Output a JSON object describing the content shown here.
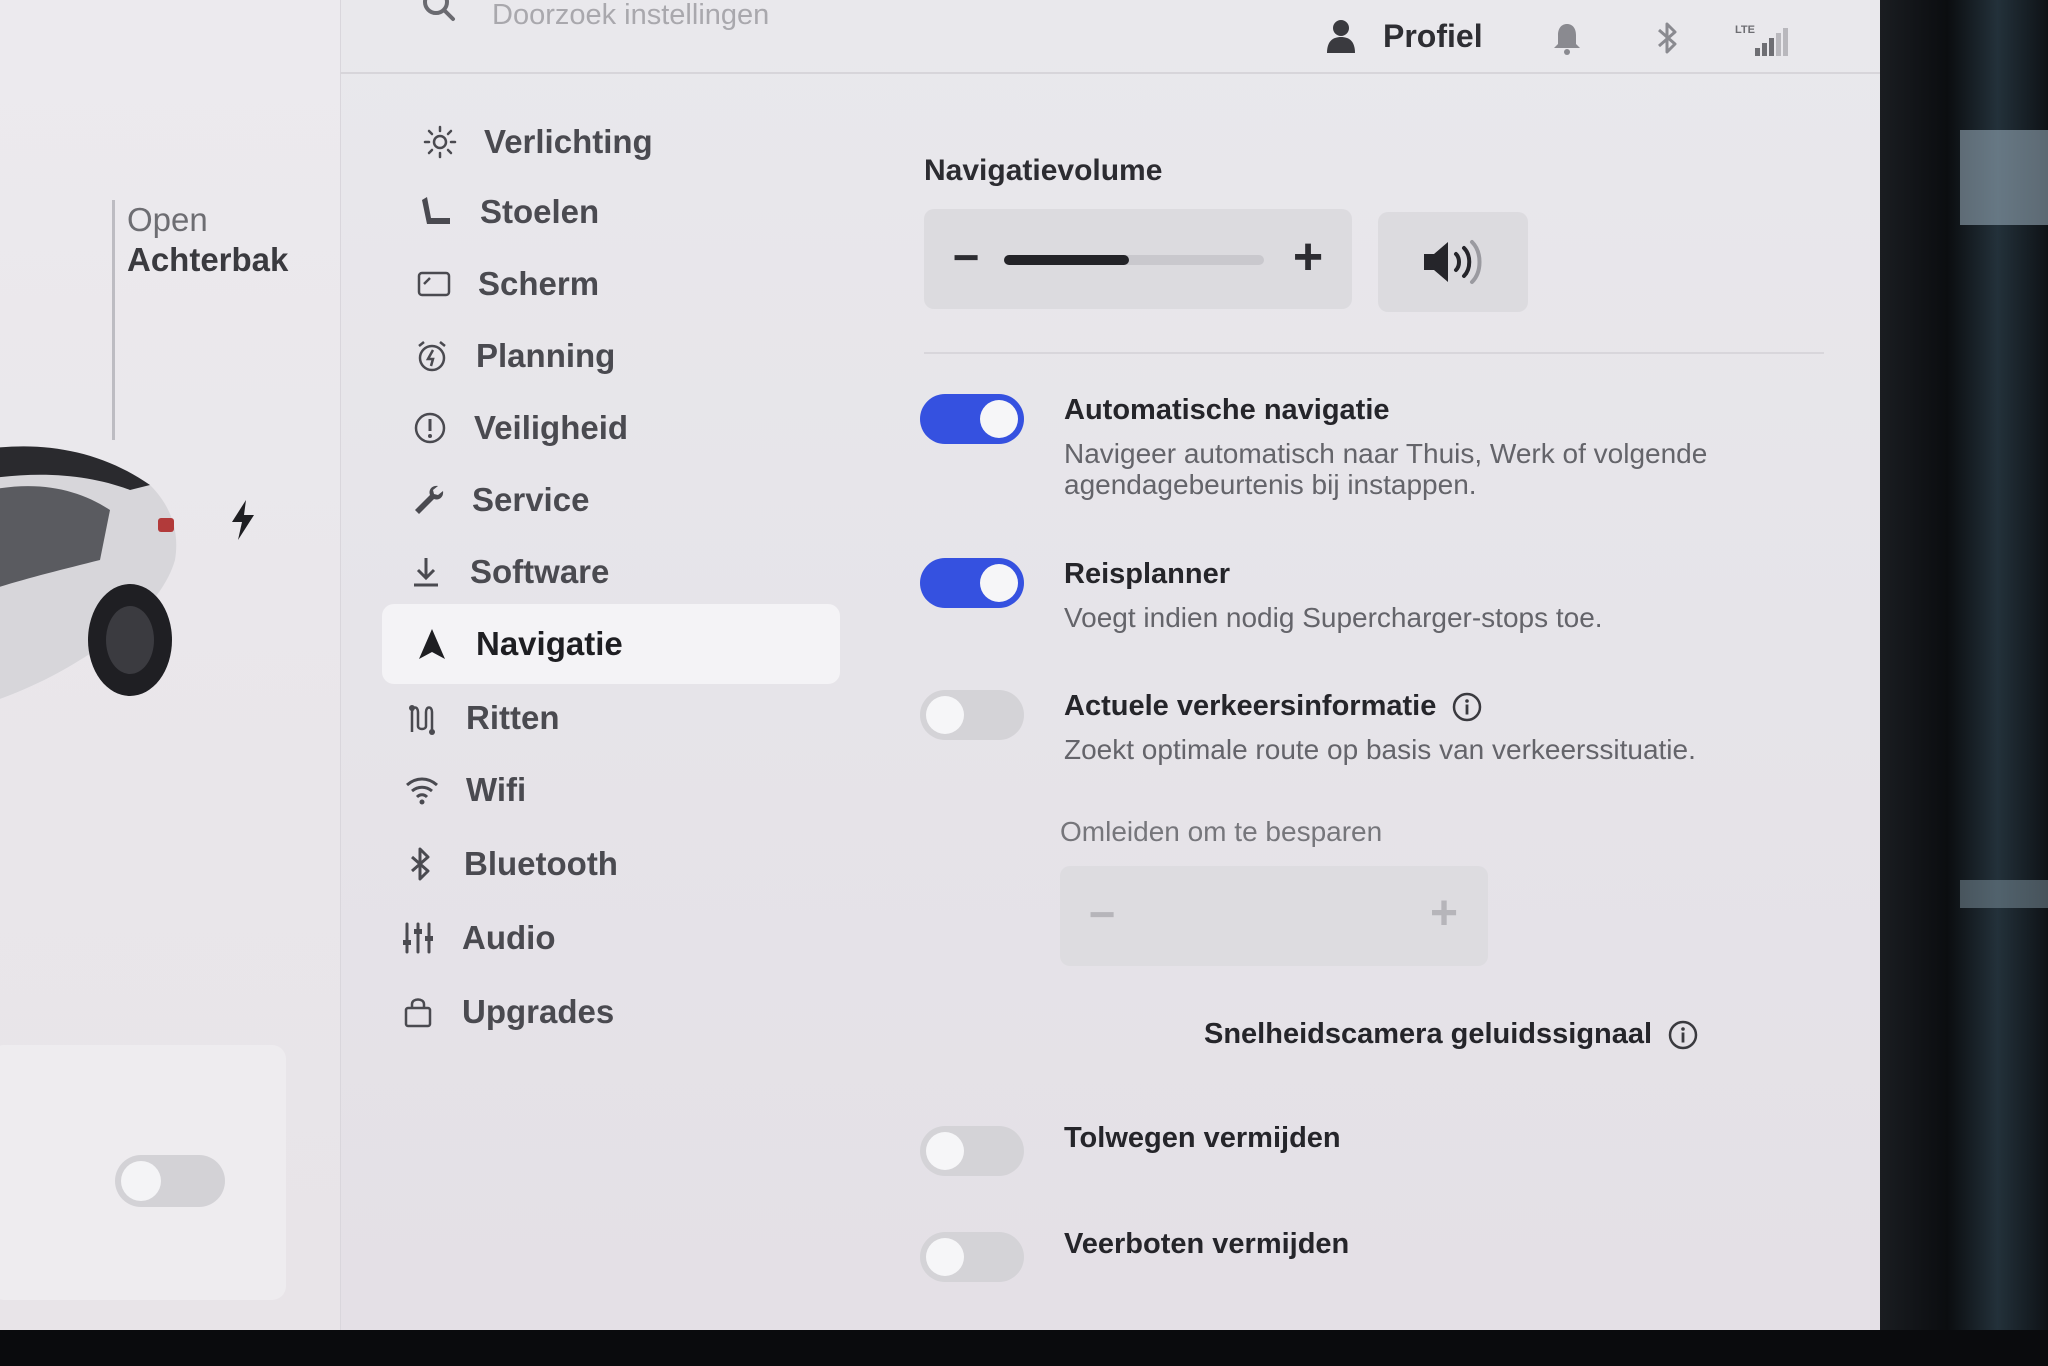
{
  "topbar": {
    "search_placeholder": "Doorzoek instellingen",
    "profile_label": "Profiel",
    "signal_label": "LTE"
  },
  "car_panel": {
    "trunk_line1": "Open",
    "trunk_line2": "Achterbak"
  },
  "nav": {
    "items": [
      {
        "label": "Verlichting",
        "icon": "sun-icon"
      },
      {
        "label": "Stoelen",
        "icon": "seat-icon"
      },
      {
        "label": "Scherm",
        "icon": "display-icon"
      },
      {
        "label": "Planning",
        "icon": "alarm-clock-icon"
      },
      {
        "label": "Veiligheid",
        "icon": "alert-circle-icon"
      },
      {
        "label": "Service",
        "icon": "wrench-icon"
      },
      {
        "label": "Software",
        "icon": "download-icon"
      },
      {
        "label": "Navigatie",
        "icon": "navigation-arrow-icon",
        "active": true
      },
      {
        "label": "Ritten",
        "icon": "trips-icon"
      },
      {
        "label": "Wifi",
        "icon": "wifi-icon"
      },
      {
        "label": "Bluetooth",
        "icon": "bluetooth-icon"
      },
      {
        "label": "Audio",
        "icon": "equalizer-icon"
      },
      {
        "label": "Upgrades",
        "icon": "shopping-bag-icon"
      }
    ]
  },
  "navigation": {
    "volume_title": "Navigatievolume",
    "volume_level": 0.48,
    "options": [
      {
        "title": "Automatische navigatie",
        "desc": "Navigeer automatisch naar Thuis, Werk of volgende agendagebeurtenis bij instappen.",
        "on": true
      },
      {
        "title": "Reisplanner",
        "desc": "Voegt indien nodig Supercharger-stops toe.",
        "on": true
      },
      {
        "title": "Actuele verkeersinformatie",
        "desc": "Zoekt optimale route op basis van verkeerssituatie.",
        "on": false
      }
    ],
    "omleiden_label": "Omleiden om te besparen",
    "speedcam_label": "Snelheidscamera geluidssignaal",
    "toll_label": "Tolwegen vermijden",
    "ferry_label": "Veerboten vermijden"
  },
  "colors": {
    "accent": "#3551e0",
    "background": "#e8e6ea",
    "text": "#25252a"
  }
}
